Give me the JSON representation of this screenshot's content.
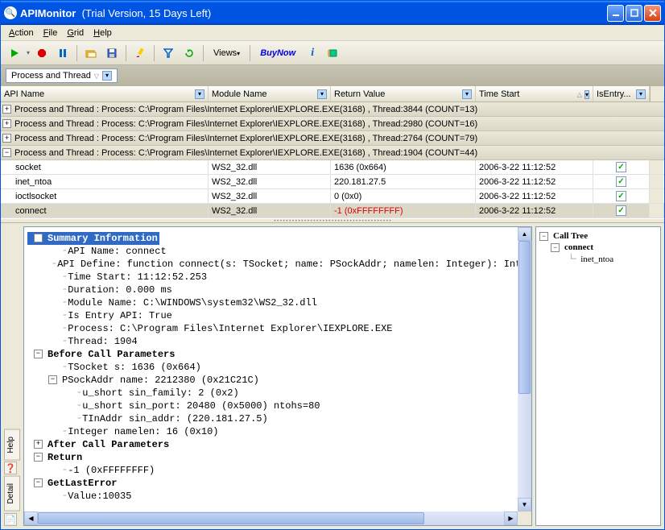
{
  "title_app": "APIMonitor",
  "title_suffix": "(Trial Version, 15 Days Left)",
  "menus": [
    "Action",
    "File",
    "Grid",
    "Help"
  ],
  "toolbar": {
    "views": "Views",
    "buynow": "BuyNow"
  },
  "filter": {
    "label": "Process and Thread"
  },
  "columns": {
    "api_name": "API Name",
    "module_name": "Module Name",
    "return_value": "Return Value",
    "time_start": "Time Start",
    "is_entry": "IsEntry..."
  },
  "groups": [
    {
      "expanded": false,
      "text": "Process and Thread : Process: C:\\Program Files\\Internet Explorer\\IEXPLORE.EXE(3168) , Thread:3844 (COUNT=13)"
    },
    {
      "expanded": false,
      "text": "Process and Thread : Process: C:\\Program Files\\Internet Explorer\\IEXPLORE.EXE(3168) , Thread:2980 (COUNT=16)"
    },
    {
      "expanded": false,
      "text": "Process and Thread : Process: C:\\Program Files\\Internet Explorer\\IEXPLORE.EXE(3168) , Thread:2764 (COUNT=79)"
    },
    {
      "expanded": true,
      "text": "Process and Thread : Process: C:\\Program Files\\Internet Explorer\\IEXPLORE.EXE(3168) , Thread:1904 (COUNT=44)"
    }
  ],
  "rows": [
    {
      "api": "socket",
      "module": "WS2_32.dll",
      "ret": "1636 (0x664)",
      "ret_red": false,
      "time": "2006-3-22 11:12:52",
      "entry": true,
      "selected": false
    },
    {
      "api": "inet_ntoa",
      "module": "WS2_32.dll",
      "ret": "220.181.27.5",
      "ret_red": false,
      "time": "2006-3-22 11:12:52",
      "entry": true,
      "selected": false
    },
    {
      "api": "ioctlsocket",
      "module": "WS2_32.dll",
      "ret": "0 (0x0)",
      "ret_red": false,
      "time": "2006-3-22 11:12:52",
      "entry": true,
      "selected": false
    },
    {
      "api": "connect",
      "module": "WS2_32.dll",
      "ret": "-1 (0xFFFFFFFF)",
      "ret_red": true,
      "time": "2006-3-22 11:12:52",
      "entry": true,
      "selected": true
    }
  ],
  "detail": {
    "summary_title": "Summary Information",
    "api_name": "API Name: connect",
    "api_define": "API Define: function connect(s: TSocket; name: PSockAddr; namelen: Integer): Integer;",
    "time_start": "Time Start: 11:12:52.253",
    "duration": "Duration: 0.000 ms",
    "module": "Module Name: C:\\WINDOWS\\system32\\WS2_32.dll",
    "is_entry": "Is Entry API: True",
    "process": "Process: C:\\Program Files\\Internet Explorer\\IEXPLORE.EXE",
    "thread": "Thread: 1904",
    "before_title": "Before Call Parameters",
    "p_tsocket": "TSocket  s: 1636 (0x664)",
    "p_psock": "PSockAddr  name: 2212380 (0x21C21C)",
    "p_family": "u_short  sin_family: 2 (0x2)",
    "p_port": "u_short  sin_port: 20480 (0x5000) ntohs=80",
    "p_addr": "TInAddr  sin_addr: (220.181.27.5)",
    "p_namelen": "Integer  namelen: 16 (0x10)",
    "after_title": "After Call Parameters",
    "return_title": "Return",
    "return_val": "-1 (0xFFFFFFFF)",
    "gle_title": "GetLastError",
    "gle_val": "Value:10035"
  },
  "call_tree": {
    "title": "Call Tree",
    "root": "connect",
    "child": "inet_ntoa"
  },
  "side_tabs": {
    "help": "Help",
    "detail": "Detail"
  }
}
